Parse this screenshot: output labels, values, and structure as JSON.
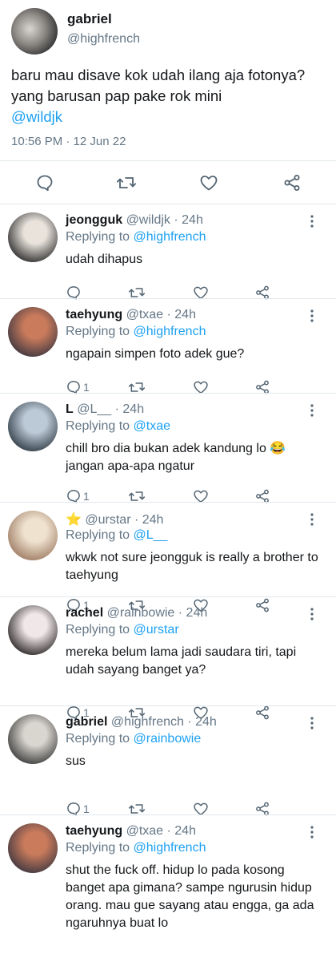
{
  "main_tweet": {
    "name": "gabriel",
    "handle": "@highfrench",
    "text": "baru mau disave kok udah ilang aja fotonya? yang barusan pap pake rok mini",
    "mention": "@wildjk",
    "timestamp": "10:56 PM · 12 Jun 22",
    "actions": [
      "reply-icon",
      "retweet-icon",
      "like-icon",
      "share-icon"
    ]
  },
  "replies": [
    {
      "name": "jeongguk",
      "meta": "@wildjk · 24h",
      "replying_label": "Replying to",
      "replying_to": "@highfrench",
      "text": "udah dihapus",
      "reply_count": "",
      "avatar_colors": [
        "#e9e3dc",
        "#2b2b2b"
      ]
    },
    {
      "name": "taehyung",
      "meta": "@txae · 24h",
      "replying_label": "Replying to",
      "replying_to": "@highfrench",
      "text": "ngapain simpen foto adek gue?",
      "reply_count": "1",
      "avatar_colors": [
        "#c97b5c",
        "#3d3640"
      ]
    },
    {
      "name": "L",
      "meta": "@L__ · 24h",
      "replying_label": "Replying to",
      "replying_to": "@txae",
      "text": "chill bro dia bukan adek kandung lo 😂 jangan apa-apa ngatur",
      "reply_count": "1",
      "avatar_colors": [
        "#bcc9d6",
        "#2f3a44"
      ]
    },
    {
      "name": "⭐",
      "meta": "@urstar · 24h",
      "replying_label": "Replying to",
      "replying_to": "@L__",
      "text": "wkwk not sure jeongguk is really a brother to taehyung",
      "reply_count": "1",
      "avatar_colors": [
        "#efe2cf",
        "#9d7a62"
      ]
    },
    {
      "name": "rachel",
      "meta": "@rainbowie · 24h",
      "replying_label": "Replying to",
      "replying_to": "@urstar",
      "text": "mereka belum lama jadi saudara tiri, tapi udah sayang banget ya?",
      "reply_count": "1",
      "avatar_colors": [
        "#f0e8e8",
        "#2a2424"
      ]
    },
    {
      "name": "gabriel",
      "meta": "@highfrench · 24h",
      "replying_label": "Replying to",
      "replying_to": "@rainbowie",
      "text": "sus",
      "reply_count": "1",
      "avatar_colors": [
        "#d9d5cf",
        "#3a3a3a"
      ]
    },
    {
      "name": "taehyung",
      "meta": "@txae · 24h",
      "replying_label": "Replying to",
      "replying_to": "@highfrench",
      "text": "shut the fuck off. hidup lo pada kosong banget apa gimana? sampe ngurusin hidup orang. mau gue sayang atau engga, ga ada ngaruhnya buat lo",
      "reply_count": "",
      "avatar_colors": [
        "#c97b5c",
        "#3d3640"
      ]
    }
  ],
  "colors": {
    "link": "#1da1f2",
    "muted": "#657786",
    "text": "#14171a",
    "divider": "#e1e8ed"
  }
}
